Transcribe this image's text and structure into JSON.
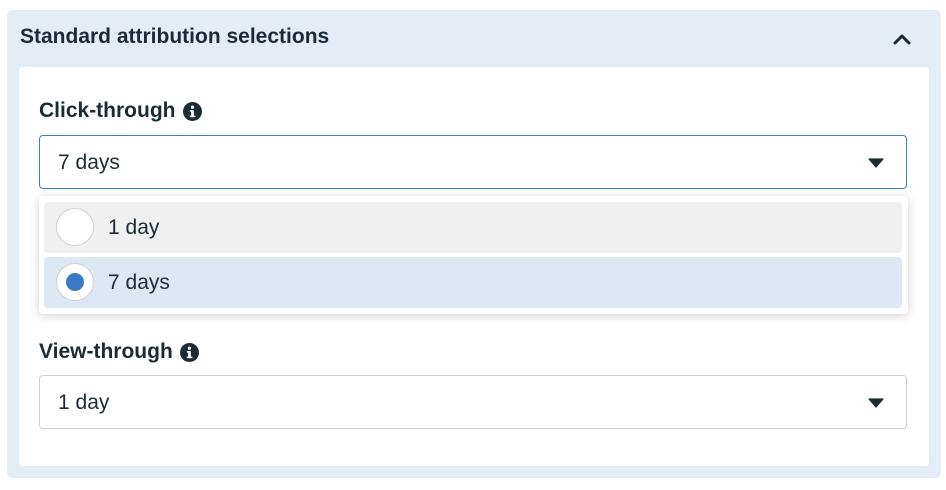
{
  "panel": {
    "title": "Standard attribution selections",
    "collapse_icon": "chevron-up-icon"
  },
  "click_through": {
    "label": "Click-through",
    "info_icon": "info-icon",
    "value": "7 days"
  },
  "dropdown": {
    "options": [
      {
        "label": "1 day",
        "selected": false
      },
      {
        "label": "7 days",
        "selected": true
      }
    ]
  },
  "view_through": {
    "label": "View-through",
    "info_icon": "info-icon",
    "value": "1 day"
  },
  "colors": {
    "panel_bg": "#e4edf6",
    "accent": "#3a7bc2",
    "selected_option_bg": "#dde8f4",
    "text": "#1c2b33"
  }
}
